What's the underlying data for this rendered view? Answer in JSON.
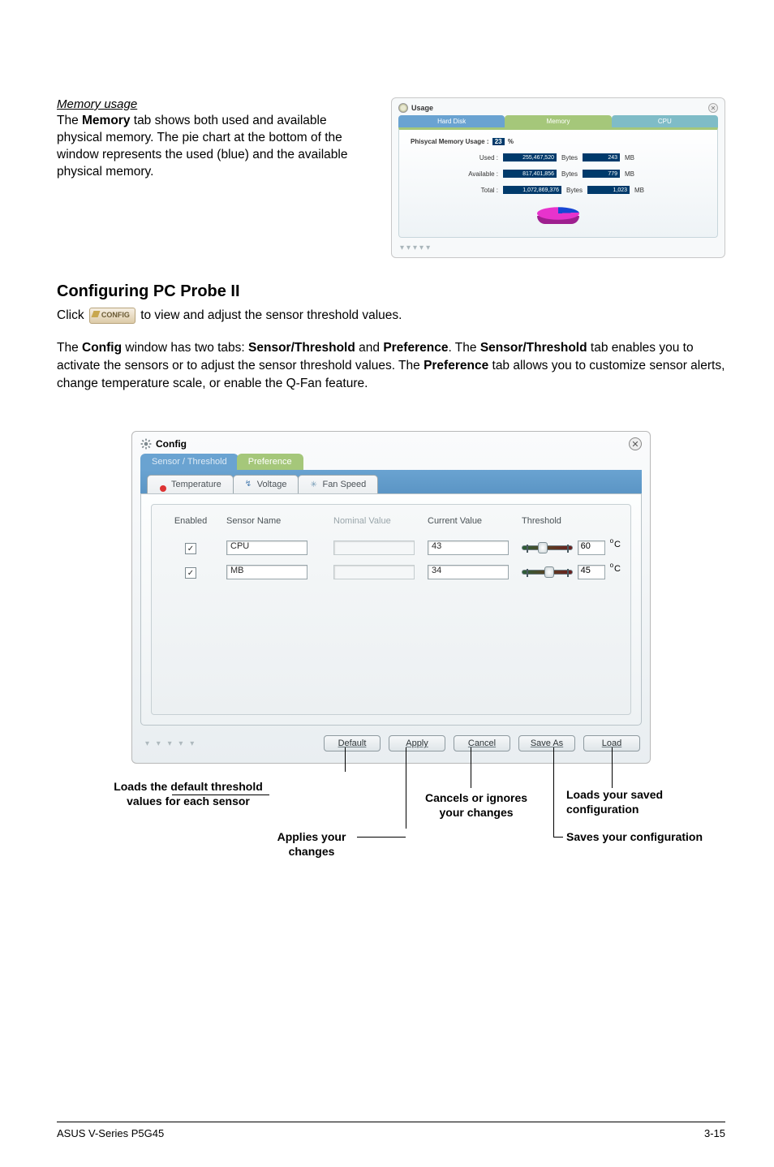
{
  "memory": {
    "heading": "Memory usage",
    "body": "The Memory tab shows both used and available physical memory. The pie chart at the bottom of the window represents the used (blue) and the available physical memory."
  },
  "usage": {
    "title": "Usage",
    "tabs": {
      "hd": "Hard Disk",
      "mem": "Memory",
      "cpu": "CPU"
    },
    "pmu_label": "Phisycal Memory Usage :",
    "pmu_pct": "23",
    "pmu_unit": "%",
    "rows": {
      "used": {
        "label": "Used :",
        "bytes": "255,467,520",
        "bytes_unit": "Bytes",
        "mb": "243",
        "mb_unit": "MB"
      },
      "avail": {
        "label": "Available :",
        "bytes": "817,401,856",
        "bytes_unit": "Bytes",
        "mb": "779",
        "mb_unit": "MB"
      },
      "total": {
        "label": "Total :",
        "bytes": "1,072,869,376",
        "bytes_unit": "Bytes",
        "mb": "1,023",
        "mb_unit": "MB"
      }
    }
  },
  "cfg_head": "Configuring PC Probe II",
  "click_a": "Click ",
  "click_b": " to view and adjust the sensor threshold values.",
  "config_chip": "CONFIG",
  "para_parts": {
    "p1": "The ",
    "b1": "Config",
    "p2": " window has two tabs: ",
    "b2": "Sensor/Threshold",
    "p3": " and ",
    "b3": "Preference",
    "p4": ". The ",
    "b4": "Sensor/Threshold",
    "p5": " tab enables you to activate the sensors or to adjust the sensor threshold values. The ",
    "b5": "Preference",
    "p6": " tab allows you to customize sensor alerts, change temperature scale, or enable the Q-Fan feature."
  },
  "config_window": {
    "title": "Config",
    "lvl1": {
      "st": "Sensor / Threshold",
      "pref": "Preference"
    },
    "lvl2": {
      "temp": "Temperature",
      "volt": "Voltage",
      "fan": "Fan Speed"
    },
    "cols": {
      "en": "Enabled",
      "name": "Sensor Name",
      "nom": "Nominal Value",
      "cur": "Current Value",
      "thr": "Threshold"
    },
    "rows": [
      {
        "name": "CPU",
        "cur": "43",
        "thr": "60"
      },
      {
        "name": "MB",
        "cur": "34",
        "thr": "45"
      }
    ],
    "unit": "C",
    "buttons": {
      "def": "Default",
      "apply": "Apply",
      "cancel": "Cancel",
      "saveas": "Save As",
      "load": "Load"
    }
  },
  "callouts": {
    "default": "Loads the default threshold values for each sensor",
    "apply": "Applies your changes",
    "cancel": "Cancels or ignores your changes",
    "load": "Loads your saved configuration",
    "saveas": "Saves your configuration"
  },
  "footer": {
    "left": "ASUS V-Series P5G45",
    "right": "3-15"
  }
}
